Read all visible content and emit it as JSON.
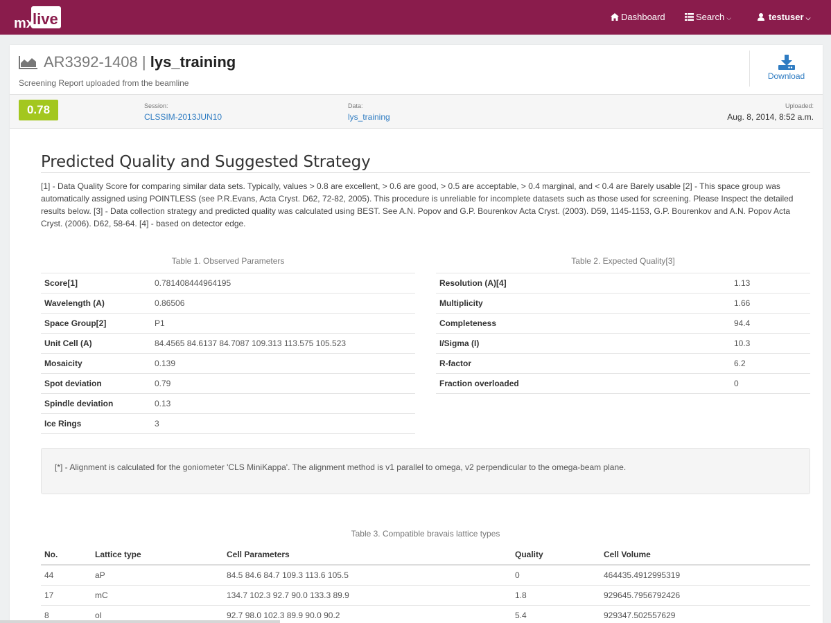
{
  "navbar": {
    "brand": "mxlive",
    "brand_left": "mx",
    "brand_right": "live",
    "dashboard_label": "Dashboard",
    "search_label": "Search",
    "user_label": "testuser",
    "accent": "#8a1c4c"
  },
  "header": {
    "id_text": "AR3392-1408",
    "separator": "|",
    "name": "lys_training",
    "subtitle": "Screening Report uploaded from the beamline",
    "download_label": "Download",
    "icon": "area-chart-icon"
  },
  "meta": {
    "score": "0.78",
    "score_color": "#a3c71f",
    "session_label": "Session:",
    "session_value": "CLSSIM-2013JUN10",
    "data_label": "Data:",
    "data_value": "lys_training",
    "uploaded_label": "Uploaded:",
    "uploaded_value": "Aug. 8, 2014, 8:52 a.m."
  },
  "section": {
    "title": "Predicted Quality and Suggested Strategy",
    "notes": "[1] - Data Quality Score for comparing similar data sets. Typically, values > 0.8 are excellent, > 0.6 are good, > 0.5 are acceptable, > 0.4 marginal, and < 0.4 are Barely usable [2] - This space group was automatically assigned using POINTLESS (see P.R.Evans, Acta Cryst. D62, 72-82, 2005). This procedure is unreliable for incomplete datasets such as those used for screening. Please Inspect the detailed results below. [3] - Data collection strategy and predicted quality was calculated using BEST. See A.N. Popov and G.P. Bourenkov Acta Cryst. (2003). D59, 1145-1153, G.P. Bourenkov and A.N. Popov Acta Cryst. (2006). D62, 58-64. [4] - based on detector edge."
  },
  "table1": {
    "caption": "Table 1. Observed Parameters",
    "rows": [
      {
        "k": "Score[1]",
        "v": "0.781408444964195"
      },
      {
        "k": "Wavelength (A)",
        "v": "0.86506"
      },
      {
        "k": "Space Group[2]",
        "v": "P1"
      },
      {
        "k": "Unit Cell (A)",
        "v": "84.4565 84.6137 84.7087 109.313 113.575 105.523"
      },
      {
        "k": "Mosaicity",
        "v": "0.139"
      },
      {
        "k": "Spot deviation",
        "v": "0.79"
      },
      {
        "k": "Spindle deviation",
        "v": "0.13"
      },
      {
        "k": "Ice Rings",
        "v": "3"
      }
    ]
  },
  "table2": {
    "caption": "Table 2. Expected Quality[3]",
    "rows": [
      {
        "k": "Resolution (A)[4]",
        "v": "1.13"
      },
      {
        "k": "Multiplicity",
        "v": "1.66"
      },
      {
        "k": "Completeness",
        "v": "94.4"
      },
      {
        "k": "I/Sigma (I)",
        "v": "10.3"
      },
      {
        "k": "R-factor",
        "v": "6.2"
      },
      {
        "k": "Fraction overloaded",
        "v": "0"
      }
    ]
  },
  "alert": {
    "text": "[*] - Alignment is calculated for the goniometer 'CLS MiniKappa'. The alignment method is v1 parallel to omega, v2 perpendicular to the omega-beam plane."
  },
  "table3": {
    "caption": "Table 3. Compatible bravais lattice types",
    "headers": [
      "No.",
      "Lattice type",
      "Cell Parameters",
      "Quality",
      "Cell Volume"
    ],
    "rows": [
      [
        "44",
        "aP",
        "84.5 84.6 84.7 109.3 113.6 105.5",
        "0",
        "464435.4912995319"
      ],
      [
        "17",
        "mC",
        "134.7 102.3 92.7 90.0 133.3 89.9",
        "1.8",
        "929645.7956792426"
      ],
      [
        "8",
        "oI",
        "92.7 98.0 102.3 89.9 90.0 90.2",
        "5.4",
        "929347.502557629"
      ]
    ]
  }
}
